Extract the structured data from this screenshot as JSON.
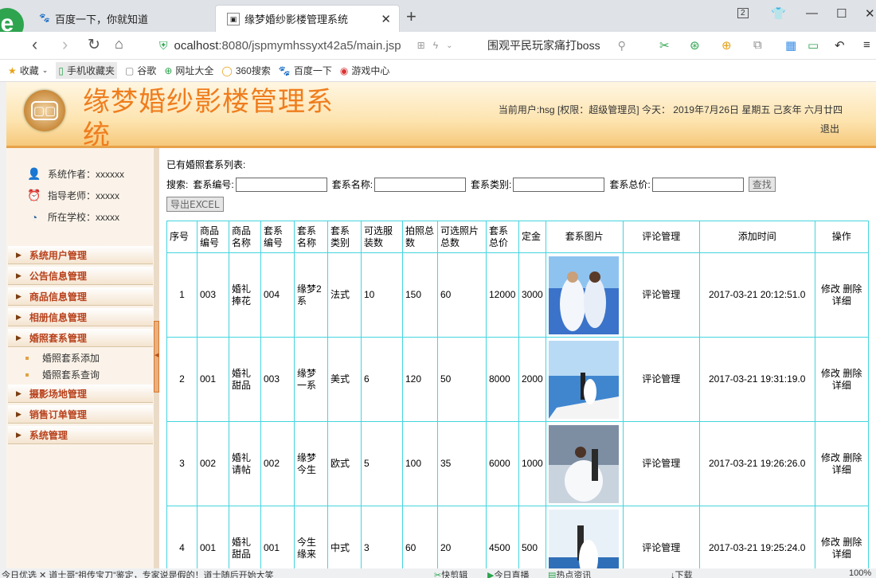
{
  "browser": {
    "logo": "e",
    "tabs": [
      {
        "title": "百度一下，你就知道",
        "icon": "paw-icon"
      },
      {
        "title": "缘梦婚纱影楼管理系统",
        "icon": "page-icon"
      }
    ],
    "tab_count": "2",
    "url_host": "ocalhost",
    "url_rest": ":8080/jspmymhssyxt42a5/main.jsp",
    "search_text": "围观平民玩家痛打boss",
    "bookmarks": [
      "收藏",
      "手机收藏夹",
      "谷歌",
      "网址大全",
      "360搜索",
      "百度一下",
      "游戏中心"
    ]
  },
  "header": {
    "title": "缘梦婚纱影楼管理系统",
    "user_info": "当前用户:hsg [权限：超级管理员] 今天： 2019年7月26日 星期五 己亥年 六月廿四",
    "logout": "退出"
  },
  "sidebar": {
    "info": [
      {
        "label": "系统作者：xxxxxx",
        "icon": "user-icon"
      },
      {
        "label": "指导老师：xxxxx",
        "icon": "teacher-icon"
      },
      {
        "label": "所在学校：xxxxx",
        "icon": "school-icon"
      }
    ],
    "menus": [
      {
        "label": "系统用户管理"
      },
      {
        "label": "公告信息管理"
      },
      {
        "label": "商品信息管理"
      },
      {
        "label": "相册信息管理"
      },
      {
        "label": "婚照套系管理",
        "children": [
          "婚照套系添加",
          "婚照套系查询"
        ]
      },
      {
        "label": "摄影场地管理"
      },
      {
        "label": "销售订单管理"
      },
      {
        "label": "系统管理"
      }
    ]
  },
  "main": {
    "list_title": "已有婚照套系列表:",
    "search": {
      "label": "搜索:",
      "fields": [
        "套系编号:",
        "套系名称:",
        "套系类别:",
        "套系总价:"
      ],
      "button": "查找",
      "export": "导出EXCEL"
    },
    "columns": [
      "序号",
      "商品编号",
      "商品名称",
      "套系编号",
      "套系名称",
      "套系类别",
      "可选服装数",
      "拍照总数",
      "可选照片总数",
      "套系总价",
      "定金",
      "套系图片",
      "评论管理",
      "添加时间",
      "操作"
    ],
    "rows": [
      {
        "idx": "1",
        "goods_no": "003",
        "goods_name": "婚礼捧花",
        "set_no": "004",
        "set_name": "缘梦2系",
        "type": "法式",
        "clothes": "10",
        "shots": "150",
        "photos": "60",
        "price": "12000",
        "deposit": "3000",
        "comment": "评论管理",
        "time": "2017-03-21 20:12:51.0",
        "edit": "修改",
        "del": "删除",
        "detail": "详细"
      },
      {
        "idx": "2",
        "goods_no": "001",
        "goods_name": "婚礼甜品",
        "set_no": "003",
        "set_name": "缘梦一系",
        "type": "美式",
        "clothes": "6",
        "shots": "120",
        "photos": "50",
        "price": "8000",
        "deposit": "2000",
        "comment": "评论管理",
        "time": "2017-03-21 19:31:19.0",
        "edit": "修改",
        "del": "删除",
        "detail": "详细"
      },
      {
        "idx": "3",
        "goods_no": "002",
        "goods_name": "婚礼请帖",
        "set_no": "002",
        "set_name": "缘梦今生",
        "type": "欧式",
        "clothes": "5",
        "shots": "100",
        "photos": "35",
        "price": "6000",
        "deposit": "1000",
        "comment": "评论管理",
        "time": "2017-03-21 19:26:26.0",
        "edit": "修改",
        "del": "删除",
        "detail": "详细"
      },
      {
        "idx": "4",
        "goods_no": "001",
        "goods_name": "婚礼甜品",
        "set_no": "001",
        "set_name": "今生缘来",
        "type": "中式",
        "clothes": "3",
        "shots": "60",
        "photos": "20",
        "price": "4500",
        "deposit": "500",
        "comment": "评论管理",
        "time": "2017-03-21 19:25:24.0",
        "edit": "修改",
        "del": "删除",
        "detail": "详细"
      }
    ]
  },
  "statusbar": {
    "news": "今日优选    ✕  道士哥“祖传宝刀”鉴定，专家说是假的！道士随后开始大笑",
    "items": [
      "快剪辑",
      "今日直播",
      "热点资讯",
      "下载",
      "100%"
    ]
  }
}
